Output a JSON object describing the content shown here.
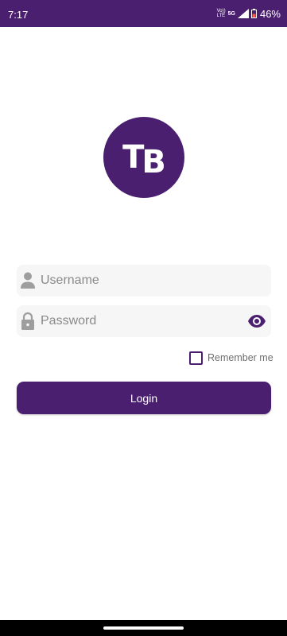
{
  "status_bar": {
    "time": "7:17",
    "volte_line1": "Vo))",
    "volte_line2": "LTE",
    "network": "5G",
    "battery": "46%"
  },
  "logo": {
    "letter1": "T",
    "letter2": "B"
  },
  "login_form": {
    "username_placeholder": "Username",
    "username_value": "",
    "password_placeholder": "Password",
    "password_value": "",
    "remember_label": "Remember me",
    "remember_checked": false,
    "login_label": "Login"
  },
  "colors": {
    "primary": "#4b1f6f",
    "field_bg": "#f6f6f6",
    "icon_gray": "#9e9e9e"
  },
  "icons": {
    "username": "person-icon",
    "password": "lock-icon",
    "toggle": "eye-icon"
  }
}
